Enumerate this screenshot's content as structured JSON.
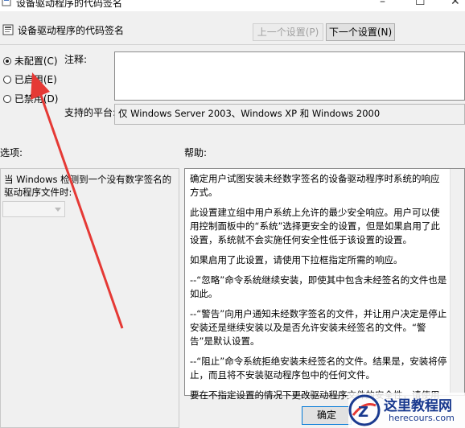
{
  "window": {
    "title": "设备驱动程序的代码签名",
    "minimize_glyph": "–",
    "maximize_glyph": "☐",
    "close_glyph": "✕"
  },
  "header": {
    "title": "设备驱动程序的代码签名",
    "prev_button": "上一个设置(P)",
    "next_button": "下一个设置(N)"
  },
  "state": {
    "options": [
      {
        "label": "未配置(C)",
        "selected": true
      },
      {
        "label": "已启用(E)",
        "selected": false
      },
      {
        "label": "已禁用(D)",
        "selected": false
      }
    ]
  },
  "comment": {
    "label": "注释:",
    "value": ""
  },
  "platform": {
    "label": "支持的平台:",
    "value": "仅 Windows Server 2003、Windows XP 和 Windows 2000"
  },
  "options_pane": {
    "label": "选项:",
    "description": "当 Windows 检测到一个没有数字签名的驱动程序文件时:",
    "combo_value": ""
  },
  "help_pane": {
    "label": "帮助:",
    "paragraphs": [
      "确定用户试图安装未经数字签名的设备驱动程序时系统的响应方式。",
      "此设置建立组中用户系统上允许的最少安全响应。用户可以使用控制面板中的“系统”选择更安全的设置，但是如果启用了此设置，系统就不会实施任何安全性低于该设置的设置。",
      "如果启用了此设置，请使用下拉框指定所需的响应。",
      "--“忽略”命令系统继续安装，即使其中包含未经签名的文件也是如此。",
      "--“警告”向用户通知未经数字签名的文件，并让用户决定是停止安装还是继续安装以及是否允许安装未经签名的文件。“警告”是默认设置。",
      "--“阻止”命令系统拒绝安装未经签名的文件。结果是，安装将停止，而且将不安装驱动程序包中的任何文件。",
      "要在不指定设置的情况下更改驱动程序文件的安全性，请使用控制面板中的“系统”。右键单击“我的电脑”，单击“属性”，单击“硬件”选项卡，然后单击“驱动程序签名”按钮。"
    ]
  },
  "footer": {
    "ok_button": "确定"
  },
  "watermark": {
    "title": "这里教程网",
    "url": "herecours.com",
    "logo_letter": "Z"
  },
  "colors": {
    "arrow": "#e53935",
    "watermark_blue": "#1a3a8f"
  }
}
